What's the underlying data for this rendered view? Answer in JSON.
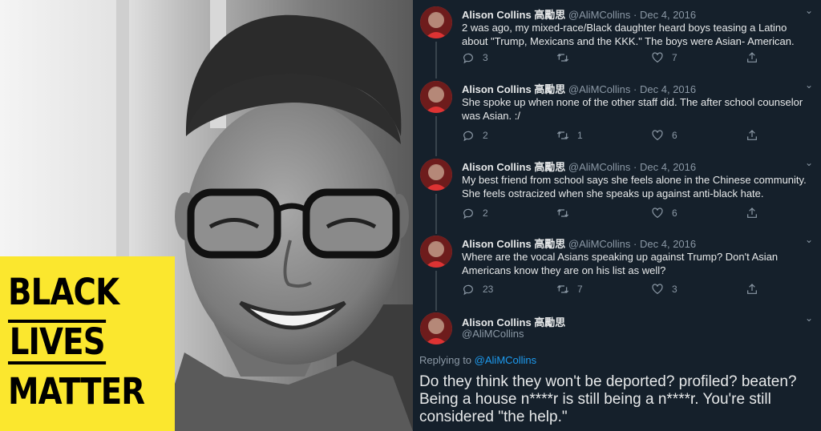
{
  "poster": {
    "lines": [
      "BLACK",
      "LIVES",
      "MATTER"
    ]
  },
  "tweets": [
    {
      "name": "Alison Collins 高勵思",
      "handle": "@AliMCollins",
      "date": "Dec 4, 2016",
      "text": "2 was ago, my mixed-race/Black daughter heard boys teasing a Latino about \"Trump, Mexicans and the KKK.\" The boys were Asian- American.",
      "replies": "3",
      "retweets": "",
      "likes": "7"
    },
    {
      "name": "Alison Collins 高勵思",
      "handle": "@AliMCollins",
      "date": "Dec 4, 2016",
      "text": "She spoke up when none of the other staff did. The after school counselor was Asian. :/",
      "replies": "2",
      "retweets": "1",
      "likes": "6"
    },
    {
      "name": "Alison Collins 高勵思",
      "handle": "@AliMCollins",
      "date": "Dec 4, 2016",
      "text": "My best friend from school says she feels alone in the Chinese community. She feels ostracized when she speaks up against anti-black hate.",
      "replies": "2",
      "retweets": "",
      "likes": "6"
    },
    {
      "name": "Alison Collins 高勵思",
      "handle": "@AliMCollins",
      "date": "Dec 4, 2016",
      "text": "Where are the vocal Asians speaking up against Trump? Don't Asian Americans know they are on his list as well?",
      "replies": "23",
      "retweets": "7",
      "likes": "3"
    }
  ],
  "final_tweet": {
    "name": "Alison Collins 高勵思",
    "handle": "@AliMCollins",
    "replying_label": "Replying to",
    "replying_handle": "@AliMCollins",
    "text": "Do they think they won't be deported? profiled? beaten? Being a house n****r is still being a n****r. You're still considered \"the help.\""
  },
  "icons": {
    "reply": "reply-icon",
    "retweet": "retweet-icon",
    "like": "heart-icon",
    "share": "share-icon",
    "more": "chevron-down-icon"
  },
  "colors": {
    "background": "#15202b",
    "poster_yellow": "#fbe72e",
    "link": "#1d9bf0",
    "muted": "#8b98a5"
  }
}
